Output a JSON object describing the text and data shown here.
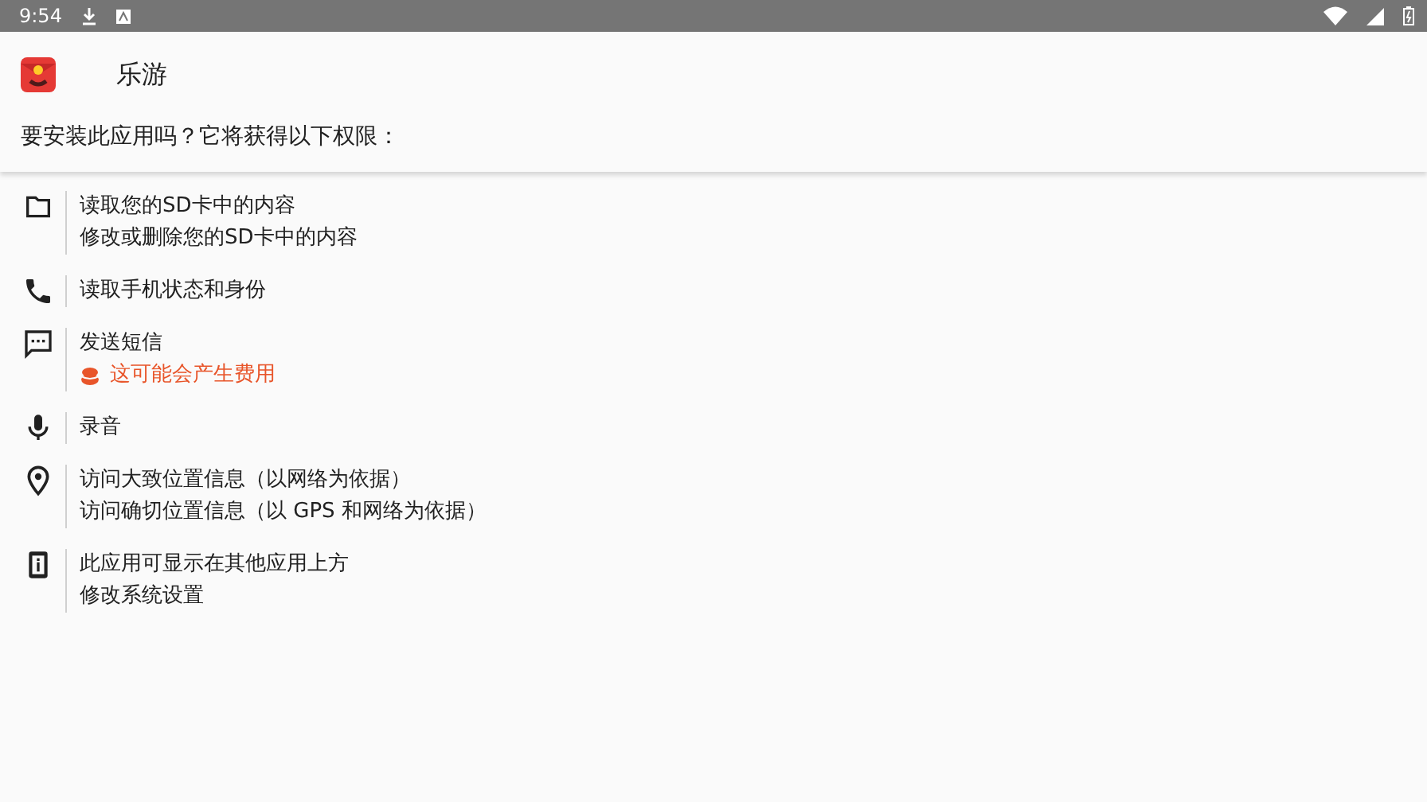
{
  "status_bar": {
    "time": "9:54"
  },
  "app": {
    "name": "乐游"
  },
  "prompt": "要安装此应用吗？它将获得以下权限：",
  "permissions": [
    {
      "kind": "storage",
      "lines": [
        {
          "text": "读取您的SD卡中的内容",
          "kind": "normal"
        },
        {
          "text": "修改或删除您的SD卡中的内容",
          "kind": "normal"
        }
      ]
    },
    {
      "kind": "phone",
      "lines": [
        {
          "text": "读取手机状态和身份",
          "kind": "normal"
        }
      ]
    },
    {
      "kind": "sms",
      "lines": [
        {
          "text": "发送短信",
          "kind": "normal"
        },
        {
          "text": "这可能会产生费用",
          "kind": "cost_warning"
        }
      ]
    },
    {
      "kind": "audio",
      "lines": [
        {
          "text": "录音",
          "kind": "normal"
        }
      ]
    },
    {
      "kind": "location",
      "lines": [
        {
          "text": "访问大致位置信息（以网络为依据）",
          "kind": "normal"
        },
        {
          "text": "访问确切位置信息（以 GPS 和网络为依据）",
          "kind": "normal"
        }
      ]
    },
    {
      "kind": "system",
      "lines": [
        {
          "text": "此应用可显示在其他应用上方",
          "kind": "normal"
        },
        {
          "text": "修改系统设置",
          "kind": "normal"
        }
      ]
    }
  ]
}
